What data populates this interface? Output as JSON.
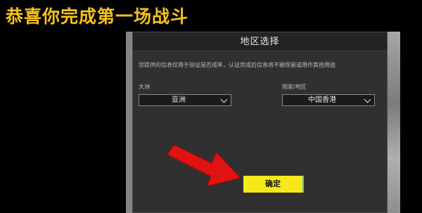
{
  "headline": "恭喜你完成第一场战斗",
  "dialog": {
    "title": "地区选择",
    "notice": "您提供的信息仅用于验证是否成年，认证完成后信息将不被保留或用作其他用途",
    "continent": {
      "label": "大洲",
      "value": "亚洲"
    },
    "region": {
      "label": "国家/地区",
      "value": "中国香港"
    },
    "confirm_label": "确定"
  },
  "colors": {
    "headline": "#f4c21b",
    "confirm": "#f6e81a",
    "arrow": "#e11212"
  },
  "icons": [
    "chevron-down-icon",
    "pointer-arrow-icon"
  ]
}
